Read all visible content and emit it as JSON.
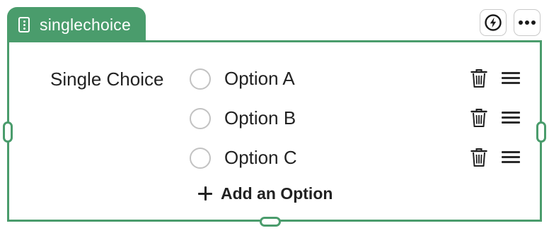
{
  "block": {
    "type_tag": "singlechoice",
    "type_icon": "form-field-icon",
    "accent_color": "#4a9c6c"
  },
  "toolbar": {
    "actions_icon": "lightning-icon",
    "more_icon": "more-horizontal-icon"
  },
  "question": {
    "label": "Single Choice",
    "options": [
      {
        "label": "Option A",
        "selected": false
      },
      {
        "label": "Option B",
        "selected": false
      },
      {
        "label": "Option C",
        "selected": false
      }
    ],
    "add_option_label": "Add an Option",
    "option_delete_icon": "trash-icon",
    "option_reorder_icon": "drag-handle-icon"
  }
}
